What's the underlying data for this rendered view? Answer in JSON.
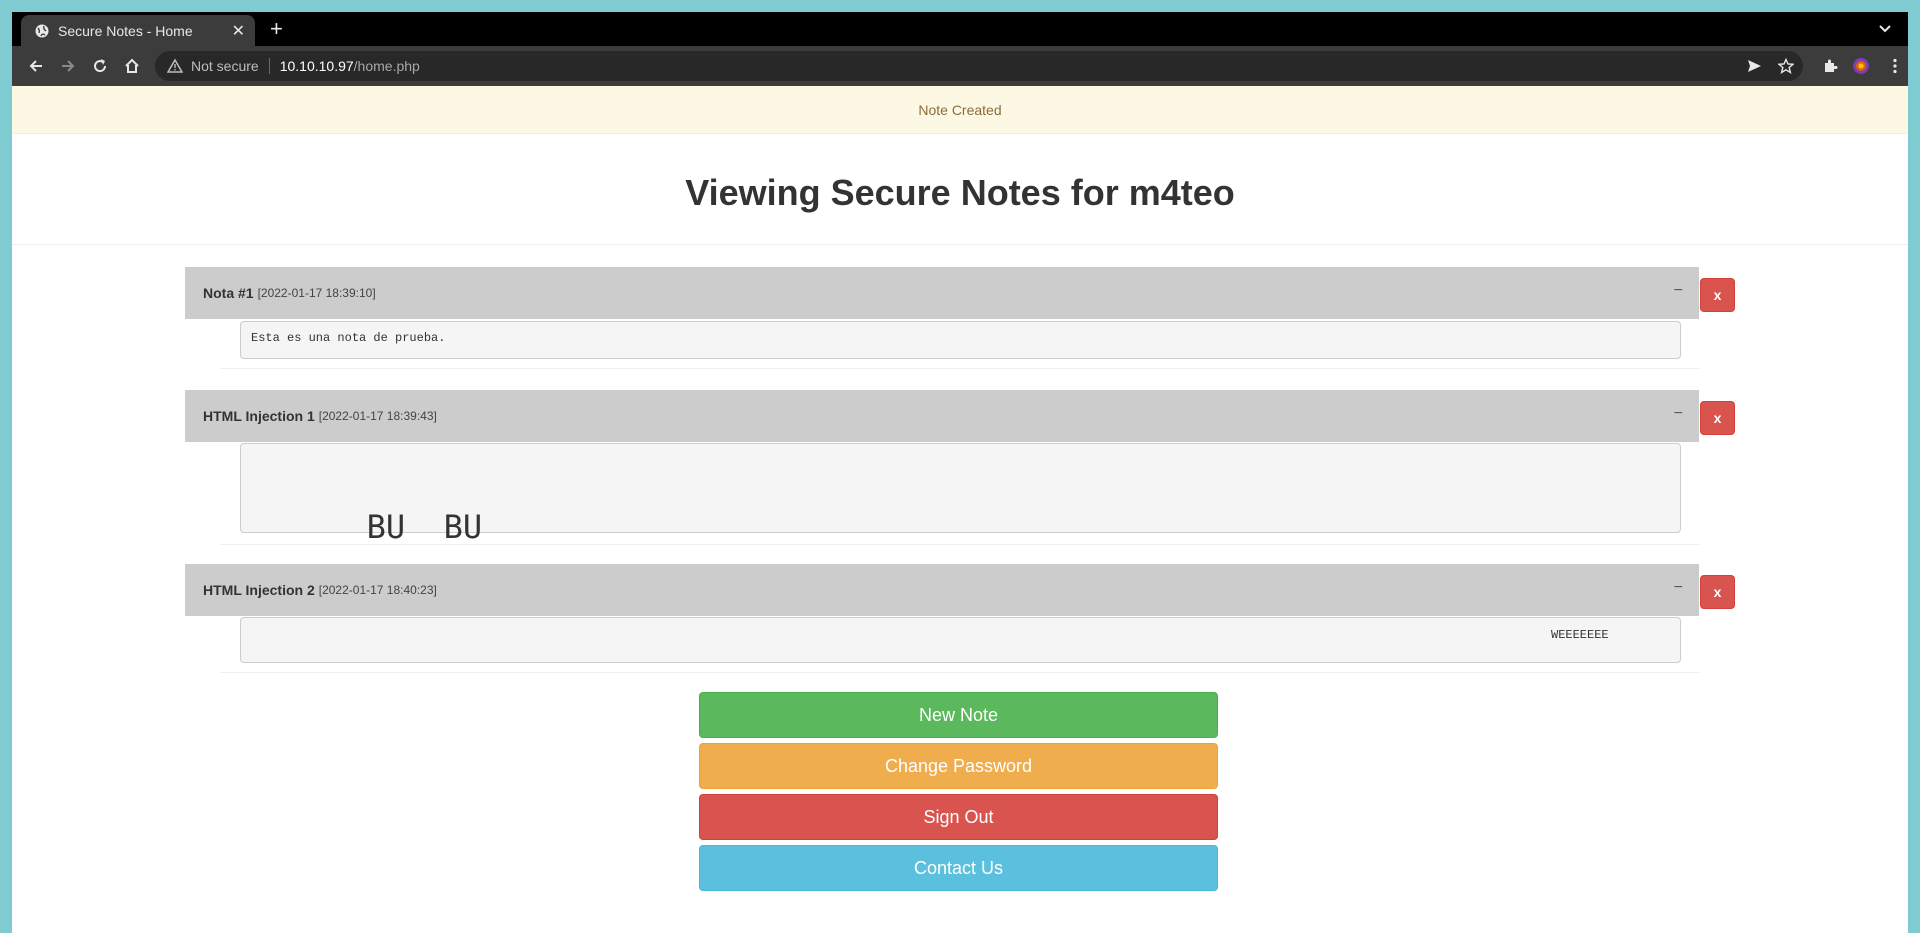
{
  "browser": {
    "tab_title": "Secure Notes - Home",
    "tab_close": "✕",
    "new_tab": "+",
    "not_secure": "Not secure",
    "url_host": "10.10.10.97",
    "url_path": "/home.php"
  },
  "alert": {
    "text": "Note Created"
  },
  "heading": {
    "prefix": "Viewing Secure Notes for ",
    "user": "m4teo"
  },
  "notes": [
    {
      "title": "Nota #1",
      "date": "[2022-01-17 18:39:10]",
      "collapse": "−",
      "delete": "x",
      "body": "Esta es una nota de prueba."
    },
    {
      "title": "HTML Injection 1",
      "date": "[2022-01-17 18:39:43]",
      "collapse": "−",
      "delete": "x",
      "body": "BU  BU"
    },
    {
      "title": "HTML Injection 2",
      "date": "[2022-01-17 18:40:23]",
      "collapse": "−",
      "delete": "x",
      "body": "WEEEEEEE"
    }
  ],
  "actions": {
    "new_note": "New Note",
    "change_password": "Change Password",
    "sign_out": "Sign Out",
    "contact_us": "Contact Us"
  },
  "colors": {
    "success": "#5cb85c",
    "warning": "#f0ad4e",
    "danger": "#d9534f",
    "info": "#5bc0de"
  }
}
